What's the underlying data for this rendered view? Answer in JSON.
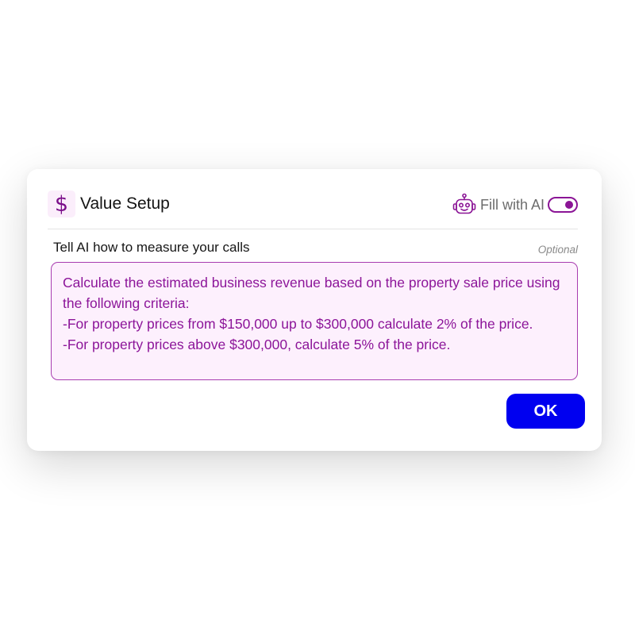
{
  "dialog": {
    "title": "Value Setup",
    "title_icon": "dollar-icon",
    "title_icon_glyph": "$",
    "ai_toggle": {
      "icon": "robot-icon",
      "label": "Fill with AI",
      "enabled": true,
      "accent_color": "#8b1596"
    },
    "prompt": {
      "label": "Tell AI how to measure your calls",
      "optional_label": "Optional",
      "value": "Calculate the estimated business revenue based on the property sale price using the following criteria:\n-For property prices from $150,000 up to $300,000 calculate 2% of the price.\n-For property prices above $300,000, calculate 5% of the price.",
      "text_color": "#8c1599",
      "background_color": "#fdf0fd"
    },
    "ok_label": "OK",
    "ok_color": "#0000f0"
  }
}
